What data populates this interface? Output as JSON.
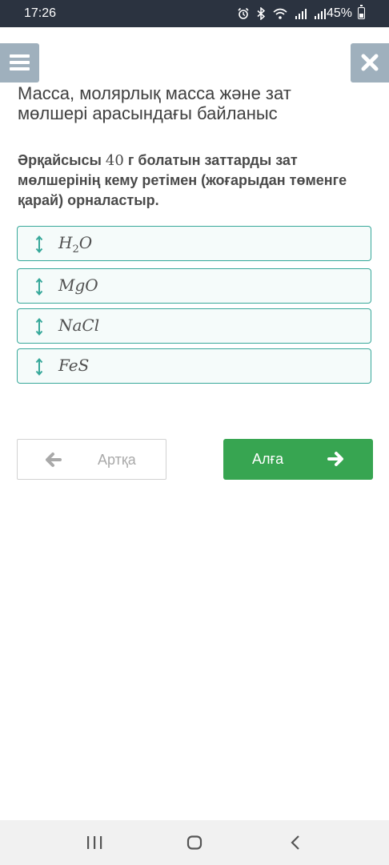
{
  "status_bar": {
    "time": "17:26",
    "battery": "45%",
    "battery_level": 0.45
  },
  "page": {
    "title": "Масса, молярлық масса және зат мөлшері арасындағы байланыс",
    "question_before": "Әрқайсысы ",
    "question_number": "40",
    "question_after": " г болатын заттарды зат мөлшерінің кему ретімен (жоғарыдан төменге қарай) орналастыр."
  },
  "items": [
    {
      "base": "H",
      "sub": "2",
      "rest": "O"
    },
    {
      "base": "MgO",
      "sub": "",
      "rest": ""
    },
    {
      "base": "NaCl",
      "sub": "",
      "rest": ""
    },
    {
      "base": "FeS",
      "sub": "",
      "rest": ""
    }
  ],
  "buttons": {
    "back_label": "Артқа",
    "next_label": "Алға"
  },
  "colors": {
    "accent": "#37a89a",
    "next": "#37a551",
    "header_button": "#9fb0bd",
    "status_bar": "#2b3340"
  }
}
